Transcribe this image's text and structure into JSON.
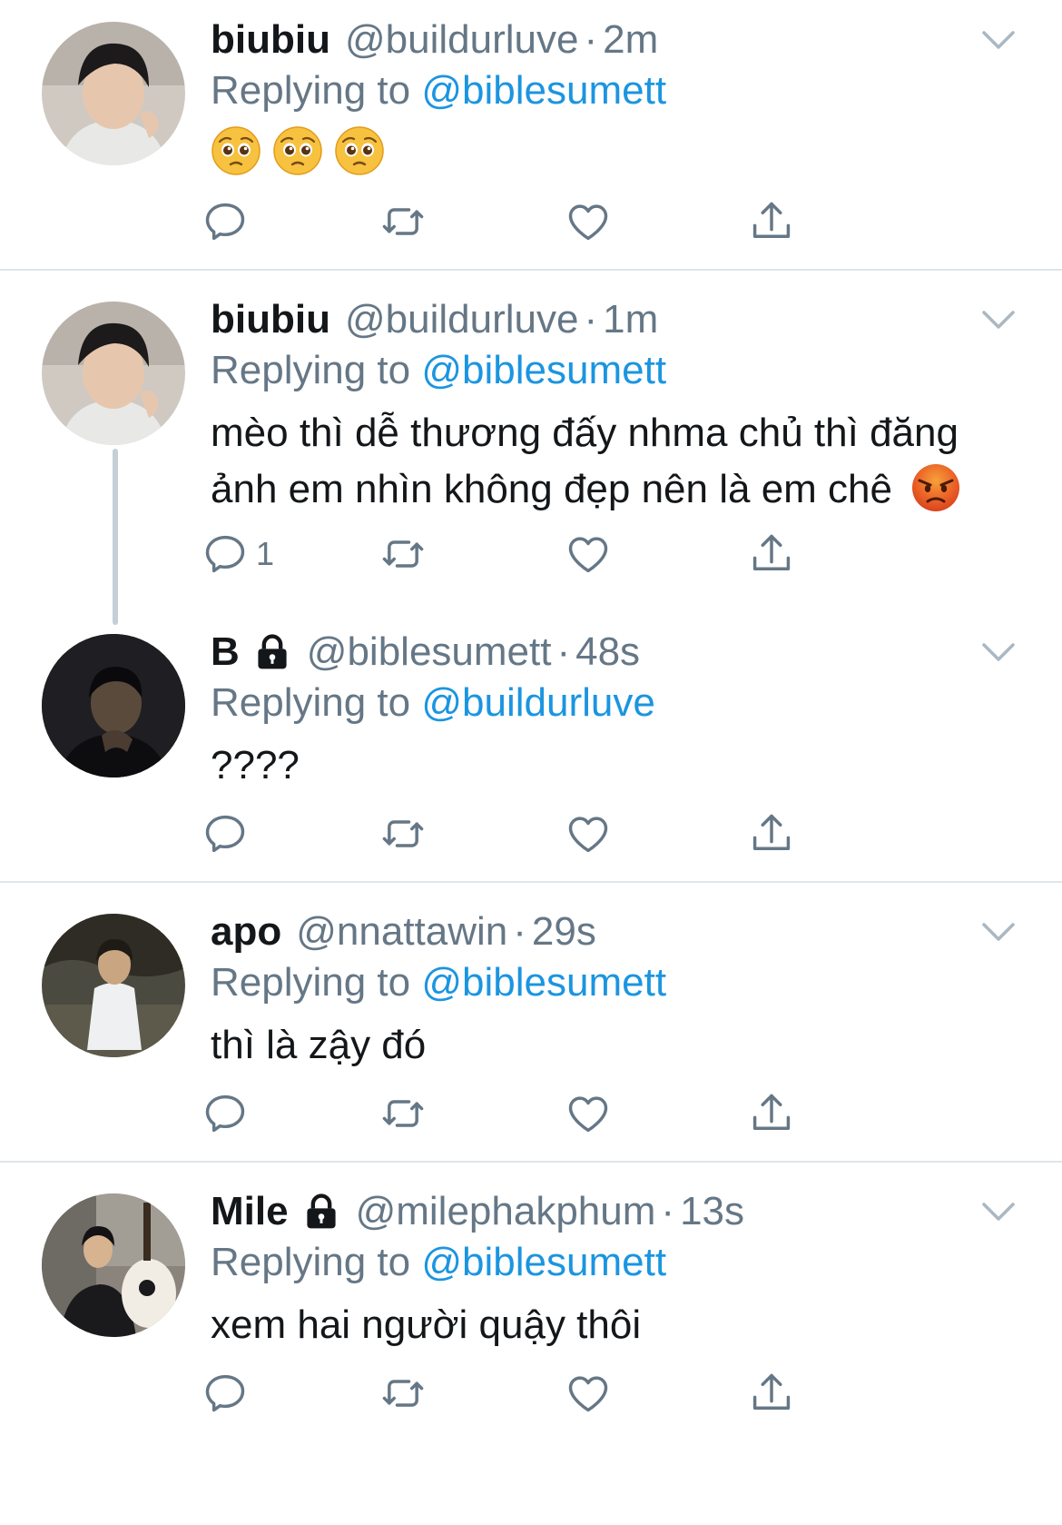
{
  "colors": {
    "link": "#1b95e0",
    "secondary_text": "#657786",
    "primary_text": "#14171a",
    "divider": "#dfe5ea",
    "thread_line": "#c4cfd6"
  },
  "reply_prefix": "Replying to",
  "dot": "·",
  "icons": [
    "reply-icon",
    "retweet-icon",
    "like-icon",
    "share-icon",
    "chevron-down-icon",
    "lock-icon"
  ],
  "tweets": [
    {
      "name": "biubiu",
      "protected": false,
      "handle": "@buildurluve",
      "time": "2m",
      "reply_to": "@biblesumett",
      "text": "🥺🥺🥺",
      "emoji": [
        "pleading-face-emoji",
        "pleading-face-emoji",
        "pleading-face-emoji"
      ],
      "reply_count": ""
    },
    {
      "name": "biubiu",
      "protected": false,
      "handle": "@buildurluve",
      "time": "1m",
      "reply_to": "@biblesumett",
      "text": "mèo thì dễ thương đấy nhma chủ thì đăng ảnh em nhìn không đẹp nên là em chê",
      "emoji": [
        "angry-face-emoji"
      ],
      "reply_count": "1"
    },
    {
      "name": "B",
      "protected": true,
      "handle": "@biblesumett",
      "time": "48s",
      "reply_to": "@buildurluve",
      "text": "????",
      "reply_count": ""
    },
    {
      "name": "apo",
      "protected": false,
      "handle": "@nnattawin",
      "time": "29s",
      "reply_to": "@biblesumett",
      "text": "thì là zậy đó",
      "reply_count": ""
    },
    {
      "name": "Mile",
      "protected": true,
      "handle": "@milephakphum",
      "time": "13s",
      "reply_to": "@biblesumett",
      "text": "xem hai người quậy thôi",
      "reply_count": ""
    }
  ]
}
